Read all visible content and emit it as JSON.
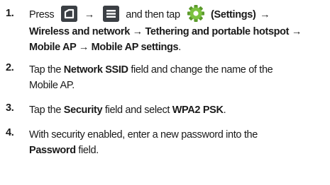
{
  "steps": [
    {
      "number": "1.",
      "press": "Press",
      "arrow1": "→",
      "then_tap": "and then tap",
      "settings_open": "(",
      "settings_label": "Settings",
      "settings_close": ")",
      "arrow2": "→",
      "path_line2": "Wireless and network → Tethering and portable hotspot →",
      "path_line3": "Mobile AP → Mobile AP settings",
      "period": ".",
      "icons": [
        "home-key-icon",
        "menu-key-icon",
        "settings-gear-icon"
      ]
    },
    {
      "number": "2.",
      "pre": "Tap the ",
      "bold": "Network SSID",
      "post1": " field and change the name of the",
      "post2": "Mobile AP."
    },
    {
      "number": "3.",
      "pre": "Tap the ",
      "bold1": "Security",
      "mid": " field and select ",
      "bold2": "WPA2 PSK",
      "post": "."
    },
    {
      "number": "4.",
      "line1": "With security enabled, enter a new password into the",
      "bold": "Password",
      "post": " field."
    }
  ],
  "colors": {
    "text": "#1a1a1a",
    "icon_dark": "#3b3f44",
    "gear_green": "#7cc23f"
  }
}
